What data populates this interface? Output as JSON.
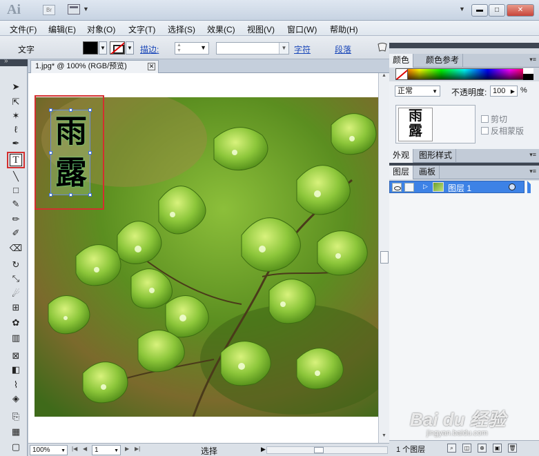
{
  "app": {
    "logo": "Ai",
    "bridge_label": "Br"
  },
  "menu": [
    "文件(F)",
    "编辑(E)",
    "对象(O)",
    "文字(T)",
    "选择(S)",
    "效果(C)",
    "视图(V)",
    "窗口(W)",
    "帮助(H)"
  ],
  "control_bar": {
    "tool_label": "文字",
    "stroke_label": "描边:",
    "char_link": "字符",
    "para_link": "段落"
  },
  "document": {
    "tab_title": "1.jpg* @ 100% (RGB/预览)",
    "glyph_top": "雨",
    "glyph_bottom": "露"
  },
  "status": {
    "zoom": "100%",
    "page": "1",
    "tool": "选择"
  },
  "panels": {
    "color_tab": "颜色",
    "color_guide_tab": "颜色参考",
    "blend_mode": "正常",
    "opacity_label": "不透明度:",
    "opacity_value": "100",
    "opacity_unit": "%",
    "clip_label": "剪切",
    "invert_mask_label": "反相蒙版",
    "appearance_tab": "外观",
    "graphic_styles_tab": "图形样式",
    "layers_tab": "图层",
    "artboards_tab": "画板",
    "layer_name": "图层 1",
    "layer_count": "1 个图层"
  },
  "watermark": {
    "brand": "Bai du 经验",
    "url": "jingyan.baidu.com"
  },
  "colors": {
    "accent_selection": "#3d82e6",
    "highlight_box": "#d32f2f",
    "link": "#1946b8"
  }
}
